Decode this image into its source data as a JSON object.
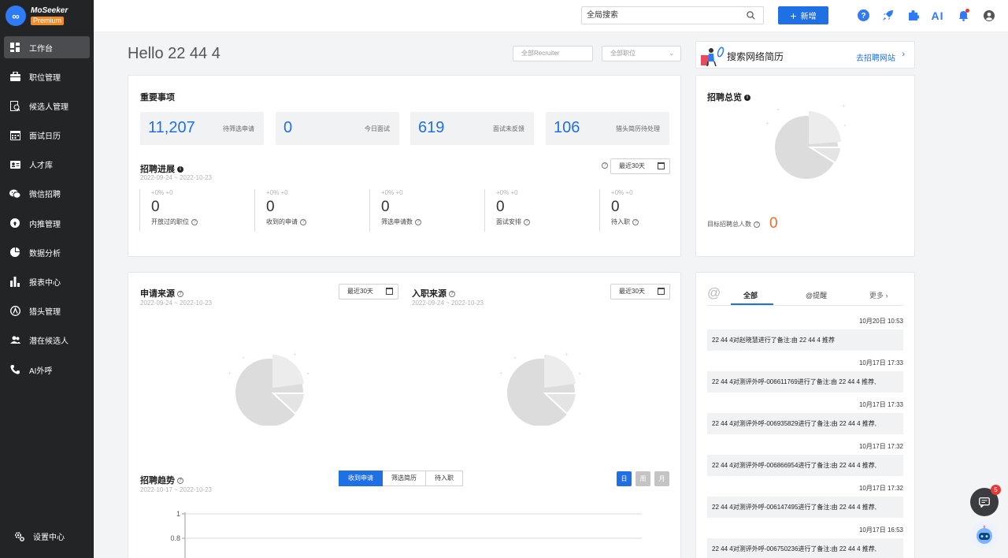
{
  "brand": {
    "name": "MoSeeker",
    "tier": "Premium",
    "logo_text": "∞"
  },
  "sidebar": {
    "items": [
      {
        "label": "工作台",
        "icon": "dashboard-icon",
        "active": true
      },
      {
        "label": "职位管理",
        "icon": "briefcase-icon"
      },
      {
        "label": "候选人管理",
        "icon": "candidate-icon"
      },
      {
        "label": "面试日历",
        "icon": "calendar-icon"
      },
      {
        "label": "人才库",
        "icon": "id-card-icon"
      },
      {
        "label": "微信招聘",
        "icon": "wechat-icon"
      },
      {
        "label": "内推管理",
        "icon": "referral-icon"
      },
      {
        "label": "数据分析",
        "icon": "pie-chart-icon"
      },
      {
        "label": "报表中心",
        "icon": "bar-chart-icon"
      },
      {
        "label": "猎头管理",
        "icon": "headhunter-icon"
      },
      {
        "label": "潜在候选人",
        "icon": "people-icon"
      },
      {
        "label": "AI外呼",
        "icon": "phone-icon"
      }
    ],
    "settings_label": "设置中心"
  },
  "topbar": {
    "search_placeholder": "全局搜索",
    "add_label": "新增",
    "ai_label": "AI"
  },
  "greeting": "Hello 22 44 4",
  "filters": {
    "recruiter": "全部Recruiter",
    "position": "全部职位"
  },
  "resume_search": {
    "label": "搜索网络简历",
    "link": "去招聘网站"
  },
  "important": {
    "title": "重要事项",
    "stats": [
      {
        "value": "11,207",
        "label": "待筛选申请"
      },
      {
        "value": "0",
        "label": "今日面试"
      },
      {
        "value": "619",
        "label": "面试未反馈"
      },
      {
        "value": "106",
        "label": "猎头简历待处理"
      }
    ]
  },
  "progress": {
    "title": "招聘进展",
    "date_range": "2022-09-24 ~ 2022-10-23",
    "range_label": "最近30天",
    "kpis": [
      {
        "delta": "+0%  +0",
        "value": "0",
        "label": "开放过的职位"
      },
      {
        "delta": "+0%  +0",
        "value": "0",
        "label": "收到的申请"
      },
      {
        "delta": "+0%  +0",
        "value": "0",
        "label": "筛选申请数"
      },
      {
        "delta": "+0%  +0",
        "value": "0",
        "label": "面试安排"
      },
      {
        "delta": "+0%  +0",
        "value": "0",
        "label": "待入职"
      }
    ]
  },
  "overview": {
    "title": "招聘总览",
    "target_label": "目标招聘总人数",
    "target_value": "0"
  },
  "sources": {
    "apply": {
      "title": "申请来源",
      "date_range": "2022-09-24 ~ 2022-10-23",
      "range_label": "最近30天"
    },
    "onboard": {
      "title": "入职来源",
      "date_range": "2022-09-24 ~ 2022-10-23",
      "range_label": "最近30天"
    }
  },
  "trend": {
    "title": "招聘趋势",
    "date_range": "2022-10-17 ~ 2022-10-23",
    "tabs": [
      "收到申请",
      "筛选简历",
      "待入职"
    ],
    "active_tab": 0,
    "periods": [
      "日",
      "周",
      "月"
    ],
    "active_period": 0
  },
  "chart_data": {
    "type": "line",
    "title": "招聘趋势",
    "yticks": [
      1,
      0.8
    ],
    "series": []
  },
  "feed": {
    "tabs": [
      "全部",
      "@提醒",
      "更多"
    ],
    "active_tab": 0,
    "items": [
      {
        "time": "10月20日 10:53",
        "text": "22 44 4对赵晓慧进行了备注:由 22 44 4 推荐"
      },
      {
        "time": "10月17日 17:33",
        "text": "22 44 4对测评外呼-006611769进行了备注:由 22 44 4 推荐,"
      },
      {
        "time": "10月17日 17:33",
        "text": "22 44 4对测评外呼-006935829进行了备注:由 22 44 4 推荐,"
      },
      {
        "time": "10月17日 17:32",
        "text": "22 44 4对测评外呼-006866954进行了备注:由 22 44 4 推荐,"
      },
      {
        "time": "10月17日 17:32",
        "text": "22 44 4对测评外呼-006147495进行了备注:由 22 44 4 推荐,"
      },
      {
        "time": "10月17日 16:53",
        "text": "22 44 4对测评外呼-006750236进行了备注:由 22 44 4 推荐,"
      }
    ]
  },
  "chat_badge": "5",
  "colors": {
    "accent": "#1f6fe5",
    "sidebar": "#222426",
    "target": "#f26b2a"
  }
}
